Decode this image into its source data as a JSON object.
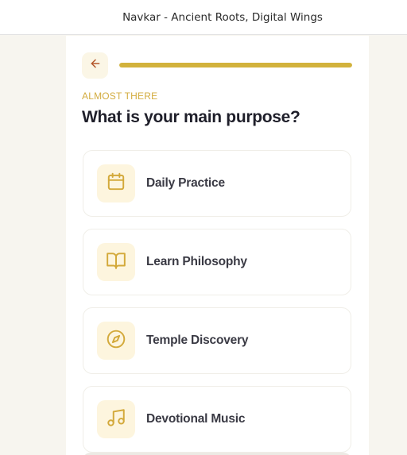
{
  "window": {
    "title": "Navkar - Ancient Roots, Digital Wings"
  },
  "onboarding": {
    "back_icon": "arrow-left-icon",
    "progress": 1.0,
    "eyebrow": "ALMOST THERE",
    "question": "What is your main purpose?",
    "options": [
      {
        "label": "Daily Practice",
        "icon": "calendar-icon"
      },
      {
        "label": "Learn Philosophy",
        "icon": "book-open-icon"
      },
      {
        "label": "Temple Discovery",
        "icon": "compass-icon"
      },
      {
        "label": "Devotional Music",
        "icon": "music-note-icon"
      }
    ]
  },
  "colors": {
    "accent": "#d2b23c",
    "icon_stroke": "#d3a93a",
    "back_arrow": "#b4572b",
    "icon_bg": "#fdf5de",
    "background": "#f7f5ef"
  }
}
